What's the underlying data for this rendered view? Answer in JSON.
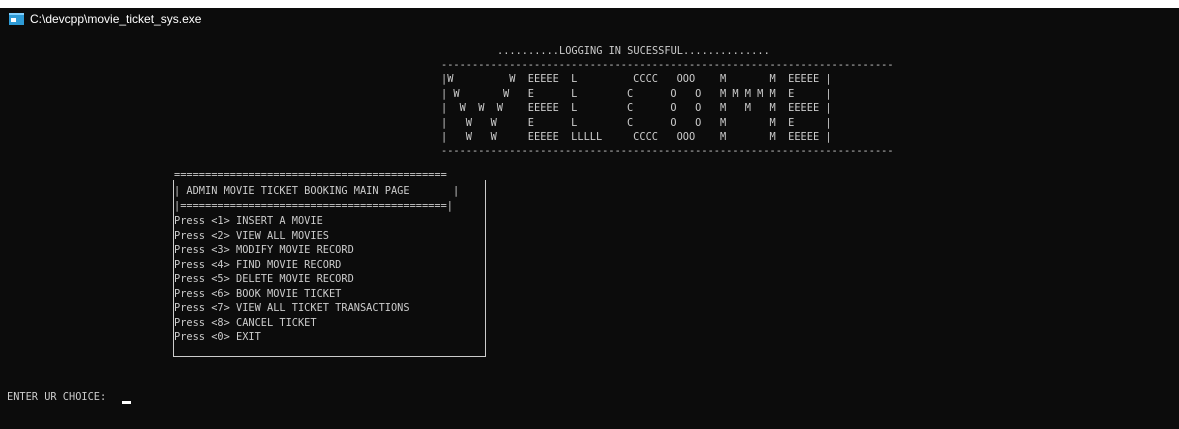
{
  "window": {
    "title": "C:\\devcpp\\movie_ticket_sys.exe",
    "icon": "console-app-icon"
  },
  "console": {
    "login_message": "..........LOGGING IN SUCESSFUL..............",
    "dash_line": "-------------------------------------------------------------------------",
    "welcome_logo": [
      "|W         W  EEEEE  L         CCCC   OOO    M       M  EEEEE |",
      "| W       W   E      L        C      O   O   M M M M M  E     |",
      "|  W  W  W    EEEEE  L        C      O   O   M   M   M  EEEEE |",
      "|   W   W     E      L        C      O   O   M       M  E     |",
      "|   W   W     EEEEE  LLLLL     CCCC   OOO    M       M  EEEEE |"
    ],
    "menu": {
      "top_border": "============================================",
      "title": "| ADMIN MOVIE TICKET BOOKING MAIN PAGE       |",
      "separator": "|===========================================|",
      "items": [
        "Press <1> INSERT A MOVIE",
        "Press <2> VIEW ALL MOVIES",
        "Press <3> MODIFY MOVIE RECORD",
        "Press <4> FIND MOVIE RECORD",
        "Press <5> DELETE MOVIE RECORD",
        "Press <6> BOOK MOVIE TICKET",
        "Press <7> VIEW ALL TICKET TRANSACTIONS",
        "Press <8> CANCEL TICKET",
        "Press <0> EXIT"
      ]
    },
    "prompt": "ENTER UR CHOICE: "
  },
  "colors": {
    "console_background": "#0c0c0c",
    "console_text": "#cccccc",
    "icon_accent": "#2e9bd6"
  }
}
